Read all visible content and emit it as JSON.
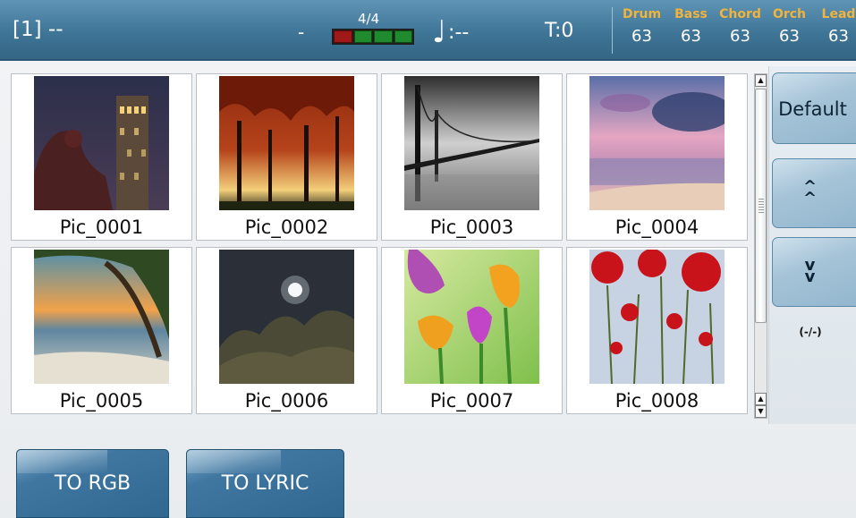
{
  "header": {
    "song_slot": "[1] --",
    "dash": "-",
    "time_signature": "4/4",
    "tempo_symbol": "♩",
    "tempo_value": ":--",
    "transpose": "T:0",
    "beat_meter": {
      "cells": 4,
      "current_beat": 1
    },
    "mixer": [
      {
        "name": "Drum",
        "value": "63"
      },
      {
        "name": "Bass",
        "value": "63"
      },
      {
        "name": "Chord",
        "value": "63"
      },
      {
        "name": "Orch",
        "value": "63"
      },
      {
        "name": "Lead",
        "value": "63"
      }
    ]
  },
  "pictures": [
    {
      "label": "Pic_0001",
      "scene": "night-tower"
    },
    {
      "label": "Pic_0002",
      "scene": "autumn-trees"
    },
    {
      "label": "Pic_0003",
      "scene": "bridge-bw"
    },
    {
      "label": "Pic_0004",
      "scene": "pink-sea"
    },
    {
      "label": "Pic_0005",
      "scene": "beach-sunset"
    },
    {
      "label": "Pic_0006",
      "scene": "moon-night"
    },
    {
      "label": "Pic_0007",
      "scene": "tulips"
    },
    {
      "label": "Pic_0008",
      "scene": "poppies"
    }
  ],
  "side_panel": {
    "default_label": "Default",
    "up_icon": "double-chevron-up-icon",
    "down_icon": "double-chevron-down-icon",
    "page_indicator": "(-/-)"
  },
  "bottom_buttons": {
    "to_rgb": "TO RGB",
    "to_lyric": "TO LYRIC"
  },
  "colors": {
    "header_blue": "#3f7597",
    "mixer_label": "#f0b43c",
    "button_blue": "#3f77a1"
  }
}
